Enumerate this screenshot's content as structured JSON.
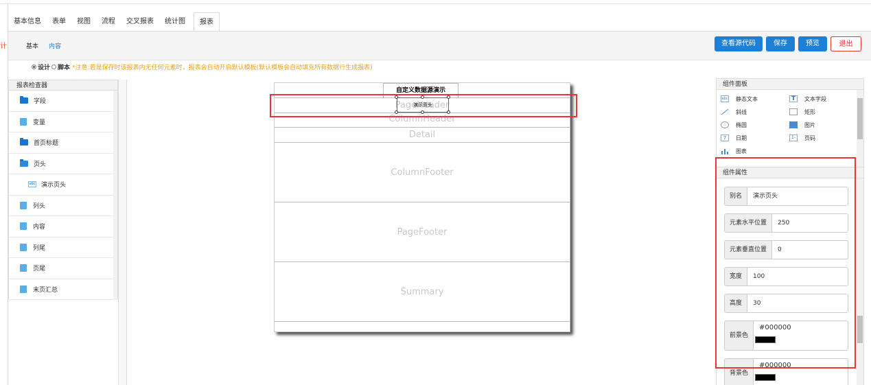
{
  "tabs": [
    "基本信息",
    "表单",
    "视图",
    "流程",
    "交叉报表",
    "统计图",
    "报表"
  ],
  "subtabs": {
    "basic": "基本",
    "content": "内容"
  },
  "buttons": {
    "source": "查看源代码",
    "save": "保存",
    "preview": "预览",
    "exit": "退出"
  },
  "mode": {
    "design": "设计",
    "script": "脚本",
    "warning": "*注意:若是保存时该报表内无任何元素时，报表会自动开启默认模板(默认模板会自动填充所有数据行生成报表)"
  },
  "left_mark": "计",
  "inspector": {
    "title": "报表检查器",
    "items": [
      {
        "label": "字段",
        "icon": "folder-icon"
      },
      {
        "label": "变量",
        "icon": "file-icon"
      },
      {
        "label": "首页标题",
        "icon": "folder-icon"
      },
      {
        "label": "页头",
        "icon": "folder-open-icon"
      },
      {
        "label": "演示页头",
        "icon": "text-element-icon"
      },
      {
        "label": "列头",
        "icon": "file-icon"
      },
      {
        "label": "内容",
        "icon": "file-icon"
      },
      {
        "label": "列尾",
        "icon": "file-icon"
      },
      {
        "label": "页尾",
        "icon": "file-icon"
      },
      {
        "label": "末页汇总",
        "icon": "file-icon"
      }
    ]
  },
  "report": {
    "title_text": "自定义数据源演示",
    "selected_text": "演示页头",
    "bands": [
      "PageHeader",
      "ColumnHeader",
      "Detail",
      "ColumnFooter",
      "PageFooter",
      "Summary"
    ]
  },
  "components": {
    "title": "组件面板",
    "items": [
      {
        "label": "静态文本",
        "icon": "abc-icon"
      },
      {
        "label": "文本字段",
        "icon": "text-field-icon"
      },
      {
        "label": "斜线",
        "icon": "line-icon"
      },
      {
        "label": "矩形",
        "icon": "rectangle-icon"
      },
      {
        "label": "椭圆",
        "icon": "ellipse-icon"
      },
      {
        "label": "图片",
        "icon": "image-icon"
      },
      {
        "label": "日期",
        "icon": "date-icon"
      },
      {
        "label": "页码",
        "icon": "page-number-icon"
      },
      {
        "label": "图表",
        "icon": "chart-icon"
      }
    ]
  },
  "properties": {
    "title": "组件属性",
    "alias_label": "别名",
    "alias_value": "演示页头",
    "x_label": "元素水平位置",
    "x_value": "250",
    "y_label": "元素垂直位置",
    "y_value": "0",
    "width_label": "宽度",
    "width_value": "100",
    "height_label": "高度",
    "height_value": "30",
    "fg_label": "前景色",
    "fg_value": "#000000",
    "bg_label": "背景色",
    "bg_value": "#000000"
  },
  "colors": {
    "primary": "#1e7fd6",
    "exit": "#e33333",
    "warning": "#f0a020",
    "highlight": "#e33333"
  }
}
